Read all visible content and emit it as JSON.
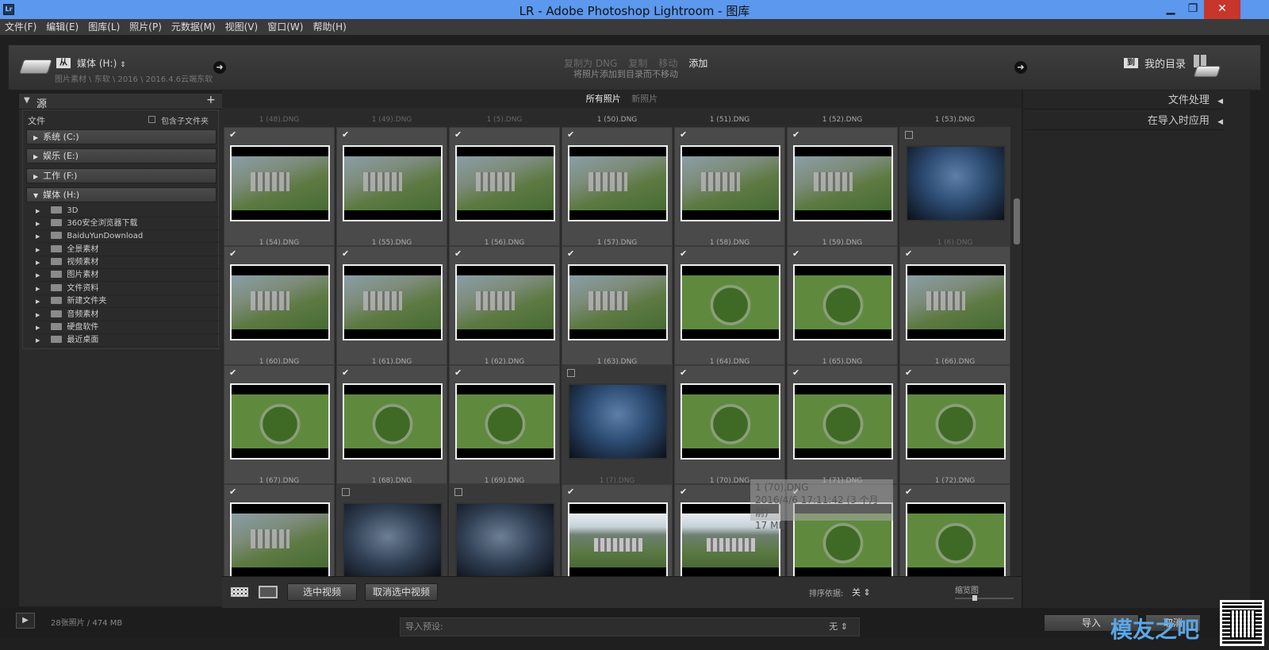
{
  "window": {
    "title": "LR - Adobe Photoshop Lightroom - 图库",
    "app_icon": "Lr"
  },
  "menu": [
    "文件(F)",
    "编辑(E)",
    "图库(L)",
    "照片(P)",
    "元数据(M)",
    "视图(V)",
    "窗口(W)",
    "帮助(H)"
  ],
  "header": {
    "from_label": "从",
    "source_name": "媒体 (H:)",
    "source_path": "图片素材 \\ 东软 \\ 2016 \\ 2016.4.6云端东软",
    "modes": [
      "复制为 DNG",
      "复制",
      "移动",
      "添加"
    ],
    "active_mode": "添加",
    "mode_description": "将照片添加到目录而不移动",
    "to_label": "到",
    "destination": "我的目录"
  },
  "source_panel": {
    "title": "源",
    "files_label": "文件",
    "include_subfolders": "包含子文件夹",
    "volumes": [
      "系统 (C:)",
      "娱乐 (E:)",
      "工作 (F:)",
      "媒体 (H:)"
    ],
    "folders": [
      "3D",
      "360安全浏览器下载",
      "BaiduYunDownload",
      "全景素材",
      "视频素材",
      "图片素材",
      "文件资料",
      "新建文件夹",
      "音频素材",
      "硬盘软件",
      "最近桌面"
    ]
  },
  "grid_tabs": {
    "all": "所有照片",
    "new": "新照片"
  },
  "top_filenames": [
    "1 (48).DNG",
    "1 (49).DNG",
    "1 (5).DNG",
    "1 (50).DNG",
    "1 (51).DNG",
    "1 (52).DNG",
    "1 (53).DNG"
  ],
  "photos": [
    {
      "name": "1 (54).DNG",
      "checked": true,
      "type": "aerial"
    },
    {
      "name": "1 (55).DNG",
      "checked": true,
      "type": "aerial"
    },
    {
      "name": "1 (56).DNG",
      "checked": true,
      "type": "aerial"
    },
    {
      "name": "1 (57).DNG",
      "checked": true,
      "type": "aerial"
    },
    {
      "name": "1 (58).DNG",
      "checked": true,
      "type": "aerial"
    },
    {
      "name": "1 (59).DNG",
      "checked": true,
      "type": "aerial"
    },
    {
      "name": "1 (6).DNG",
      "checked": false,
      "type": "sky"
    },
    {
      "name": "1 (60).DNG",
      "checked": true,
      "type": "aerial"
    },
    {
      "name": "1 (61).DNG",
      "checked": true,
      "type": "aerial"
    },
    {
      "name": "1 (62).DNG",
      "checked": true,
      "type": "aerial"
    },
    {
      "name": "1 (63).DNG",
      "checked": true,
      "type": "aerial"
    },
    {
      "name": "1 (64).DNG",
      "checked": true,
      "type": "circle"
    },
    {
      "name": "1 (65).DNG",
      "checked": true,
      "type": "circle"
    },
    {
      "name": "1 (66).DNG",
      "checked": true,
      "type": "aerial"
    },
    {
      "name": "1 (67).DNG",
      "checked": true,
      "type": "circle"
    },
    {
      "name": "1 (68).DNG",
      "checked": true,
      "type": "circle"
    },
    {
      "name": "1 (69).DNG",
      "checked": true,
      "type": "circle"
    },
    {
      "name": "1 (7).DNG",
      "checked": false,
      "type": "sky"
    },
    {
      "name": "1 (70).DNG",
      "checked": true,
      "type": "circle"
    },
    {
      "name": "1 (71).DNG",
      "checked": true,
      "type": "circle"
    },
    {
      "name": "1 (72).DNG",
      "checked": true,
      "type": "circle"
    },
    {
      "name": "",
      "checked": true,
      "type": "aerial"
    },
    {
      "name": "",
      "checked": false,
      "type": "cloud"
    },
    {
      "name": "",
      "checked": false,
      "type": "cloud"
    },
    {
      "name": "",
      "checked": true,
      "type": "mountain"
    },
    {
      "name": "",
      "checked": true,
      "type": "mountain"
    },
    {
      "name": "",
      "checked": true,
      "type": "circle"
    },
    {
      "name": "",
      "checked": true,
      "type": "circle"
    }
  ],
  "tooltip": {
    "line1": "1 (70).DNG",
    "line2": "2016/4/6 17:11:42 (3 个月前)",
    "line3": "17 MB"
  },
  "toolbar": {
    "select_video": "选中视频",
    "deselect_video": "取消选中视频",
    "sort_label": "排序依据:",
    "sort_value": "关",
    "thumb_label": "缩览图"
  },
  "right_panel": {
    "file_handling": "文件处理",
    "apply_on_import": "在导入时应用"
  },
  "bottom": {
    "count": "28张照片 / 474 MB",
    "preset_label": "导入预设:",
    "preset_value": "无",
    "import_button": "导入",
    "cancel_button": "取消",
    "watermark": "模友之吧"
  }
}
